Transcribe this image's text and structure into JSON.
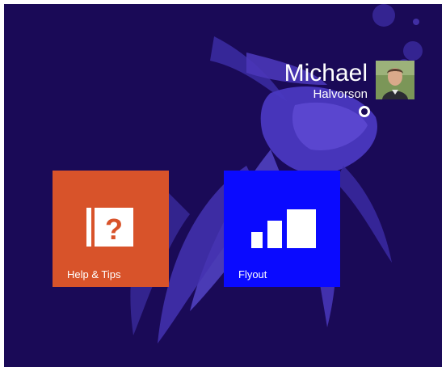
{
  "user": {
    "first_name": "Michael",
    "last_name": "Halvorson",
    "avatar_icon": "user-photo"
  },
  "tiles": [
    {
      "label": "Help & Tips",
      "icon": "help-book-icon",
      "color": "#d8532a"
    },
    {
      "label": "Flyout",
      "icon": "signal-bars-icon",
      "color": "#0a0aff"
    }
  ],
  "theme": {
    "background": "#1a0a57",
    "art_color": "#5a45c8"
  }
}
